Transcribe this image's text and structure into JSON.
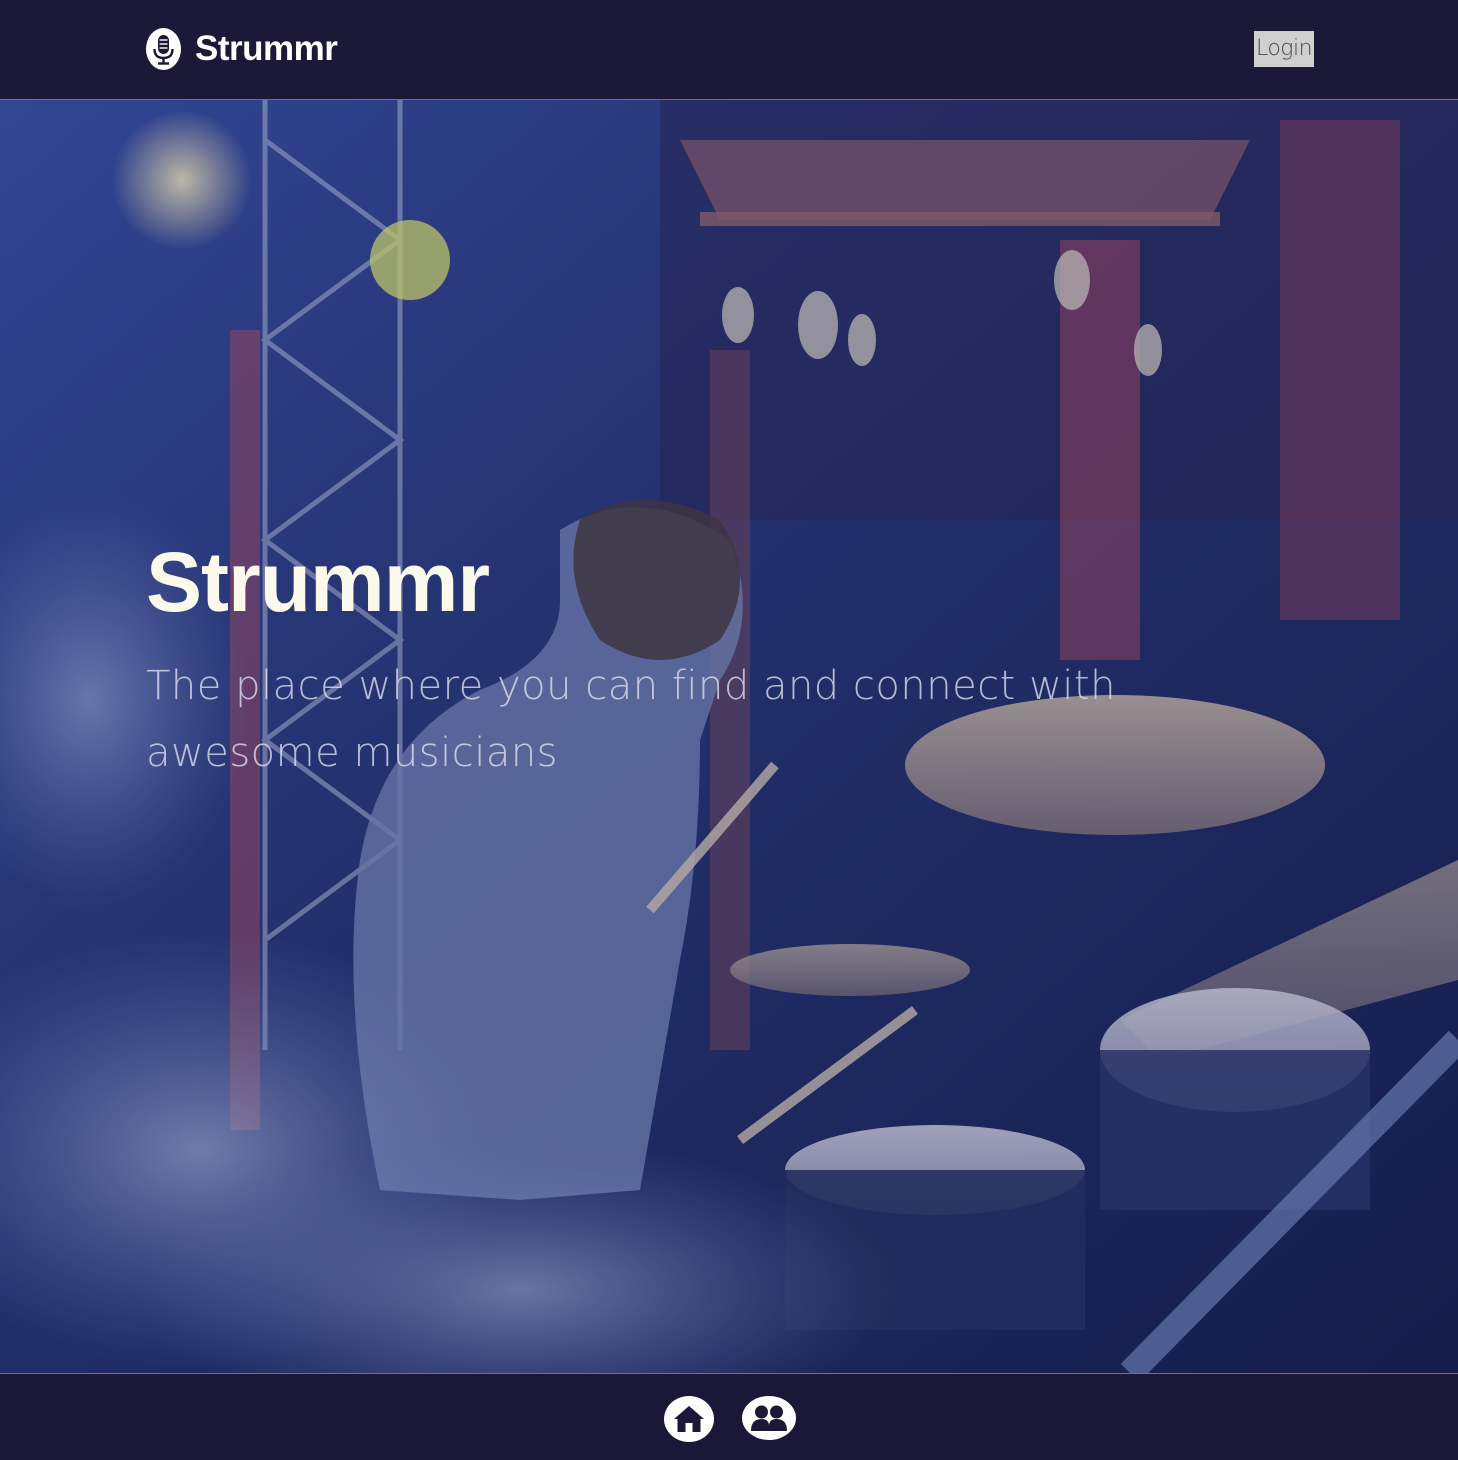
{
  "navbar": {
    "brand_name": "Strummr",
    "brand_icon": "microphone-icon",
    "login_label": "Login"
  },
  "hero": {
    "title": "Strummr",
    "subtitle": "The place where you can find and connect with awesome musicians",
    "background": "drummer-on-stage-photo"
  },
  "footer_nav": {
    "items": [
      {
        "icon": "home-icon"
      },
      {
        "icon": "users-icon"
      }
    ]
  },
  "colors": {
    "nav_background": "#1b1838",
    "hero_title": "#fbf8ec",
    "login_button_bg": "#cfcfcf",
    "icon_background": "#ffffff"
  }
}
